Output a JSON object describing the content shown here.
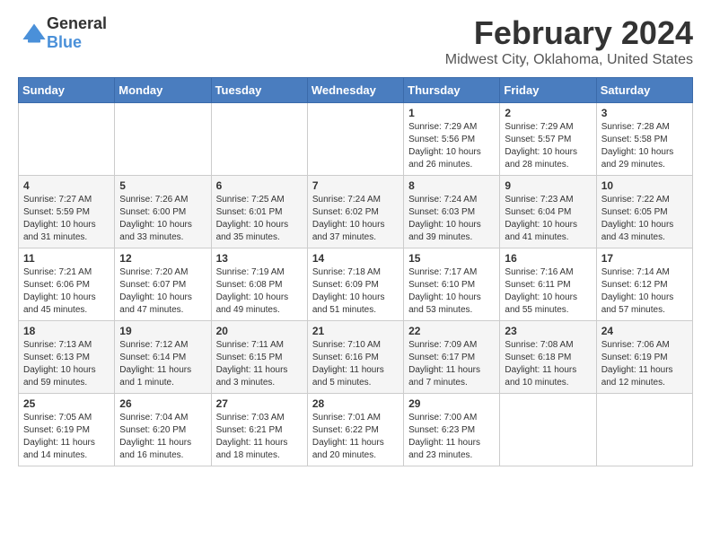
{
  "header": {
    "logo_general": "General",
    "logo_blue": "Blue",
    "title": "February 2024",
    "subtitle": "Midwest City, Oklahoma, United States"
  },
  "calendar": {
    "days_of_week": [
      "Sunday",
      "Monday",
      "Tuesday",
      "Wednesday",
      "Thursday",
      "Friday",
      "Saturday"
    ],
    "weeks": [
      [
        {
          "day": "",
          "info": ""
        },
        {
          "day": "",
          "info": ""
        },
        {
          "day": "",
          "info": ""
        },
        {
          "day": "",
          "info": ""
        },
        {
          "day": "1",
          "info": "Sunrise: 7:29 AM\nSunset: 5:56 PM\nDaylight: 10 hours\nand 26 minutes."
        },
        {
          "day": "2",
          "info": "Sunrise: 7:29 AM\nSunset: 5:57 PM\nDaylight: 10 hours\nand 28 minutes."
        },
        {
          "day": "3",
          "info": "Sunrise: 7:28 AM\nSunset: 5:58 PM\nDaylight: 10 hours\nand 29 minutes."
        }
      ],
      [
        {
          "day": "4",
          "info": "Sunrise: 7:27 AM\nSunset: 5:59 PM\nDaylight: 10 hours\nand 31 minutes."
        },
        {
          "day": "5",
          "info": "Sunrise: 7:26 AM\nSunset: 6:00 PM\nDaylight: 10 hours\nand 33 minutes."
        },
        {
          "day": "6",
          "info": "Sunrise: 7:25 AM\nSunset: 6:01 PM\nDaylight: 10 hours\nand 35 minutes."
        },
        {
          "day": "7",
          "info": "Sunrise: 7:24 AM\nSunset: 6:02 PM\nDaylight: 10 hours\nand 37 minutes."
        },
        {
          "day": "8",
          "info": "Sunrise: 7:24 AM\nSunset: 6:03 PM\nDaylight: 10 hours\nand 39 minutes."
        },
        {
          "day": "9",
          "info": "Sunrise: 7:23 AM\nSunset: 6:04 PM\nDaylight: 10 hours\nand 41 minutes."
        },
        {
          "day": "10",
          "info": "Sunrise: 7:22 AM\nSunset: 6:05 PM\nDaylight: 10 hours\nand 43 minutes."
        }
      ],
      [
        {
          "day": "11",
          "info": "Sunrise: 7:21 AM\nSunset: 6:06 PM\nDaylight: 10 hours\nand 45 minutes."
        },
        {
          "day": "12",
          "info": "Sunrise: 7:20 AM\nSunset: 6:07 PM\nDaylight: 10 hours\nand 47 minutes."
        },
        {
          "day": "13",
          "info": "Sunrise: 7:19 AM\nSunset: 6:08 PM\nDaylight: 10 hours\nand 49 minutes."
        },
        {
          "day": "14",
          "info": "Sunrise: 7:18 AM\nSunset: 6:09 PM\nDaylight: 10 hours\nand 51 minutes."
        },
        {
          "day": "15",
          "info": "Sunrise: 7:17 AM\nSunset: 6:10 PM\nDaylight: 10 hours\nand 53 minutes."
        },
        {
          "day": "16",
          "info": "Sunrise: 7:16 AM\nSunset: 6:11 PM\nDaylight: 10 hours\nand 55 minutes."
        },
        {
          "day": "17",
          "info": "Sunrise: 7:14 AM\nSunset: 6:12 PM\nDaylight: 10 hours\nand 57 minutes."
        }
      ],
      [
        {
          "day": "18",
          "info": "Sunrise: 7:13 AM\nSunset: 6:13 PM\nDaylight: 10 hours\nand 59 minutes."
        },
        {
          "day": "19",
          "info": "Sunrise: 7:12 AM\nSunset: 6:14 PM\nDaylight: 11 hours\nand 1 minute."
        },
        {
          "day": "20",
          "info": "Sunrise: 7:11 AM\nSunset: 6:15 PM\nDaylight: 11 hours\nand 3 minutes."
        },
        {
          "day": "21",
          "info": "Sunrise: 7:10 AM\nSunset: 6:16 PM\nDaylight: 11 hours\nand 5 minutes."
        },
        {
          "day": "22",
          "info": "Sunrise: 7:09 AM\nSunset: 6:17 PM\nDaylight: 11 hours\nand 7 minutes."
        },
        {
          "day": "23",
          "info": "Sunrise: 7:08 AM\nSunset: 6:18 PM\nDaylight: 11 hours\nand 10 minutes."
        },
        {
          "day": "24",
          "info": "Sunrise: 7:06 AM\nSunset: 6:19 PM\nDaylight: 11 hours\nand 12 minutes."
        }
      ],
      [
        {
          "day": "25",
          "info": "Sunrise: 7:05 AM\nSunset: 6:19 PM\nDaylight: 11 hours\nand 14 minutes."
        },
        {
          "day": "26",
          "info": "Sunrise: 7:04 AM\nSunset: 6:20 PM\nDaylight: 11 hours\nand 16 minutes."
        },
        {
          "day": "27",
          "info": "Sunrise: 7:03 AM\nSunset: 6:21 PM\nDaylight: 11 hours\nand 18 minutes."
        },
        {
          "day": "28",
          "info": "Sunrise: 7:01 AM\nSunset: 6:22 PM\nDaylight: 11 hours\nand 20 minutes."
        },
        {
          "day": "29",
          "info": "Sunrise: 7:00 AM\nSunset: 6:23 PM\nDaylight: 11 hours\nand 23 minutes."
        },
        {
          "day": "",
          "info": ""
        },
        {
          "day": "",
          "info": ""
        }
      ]
    ]
  }
}
